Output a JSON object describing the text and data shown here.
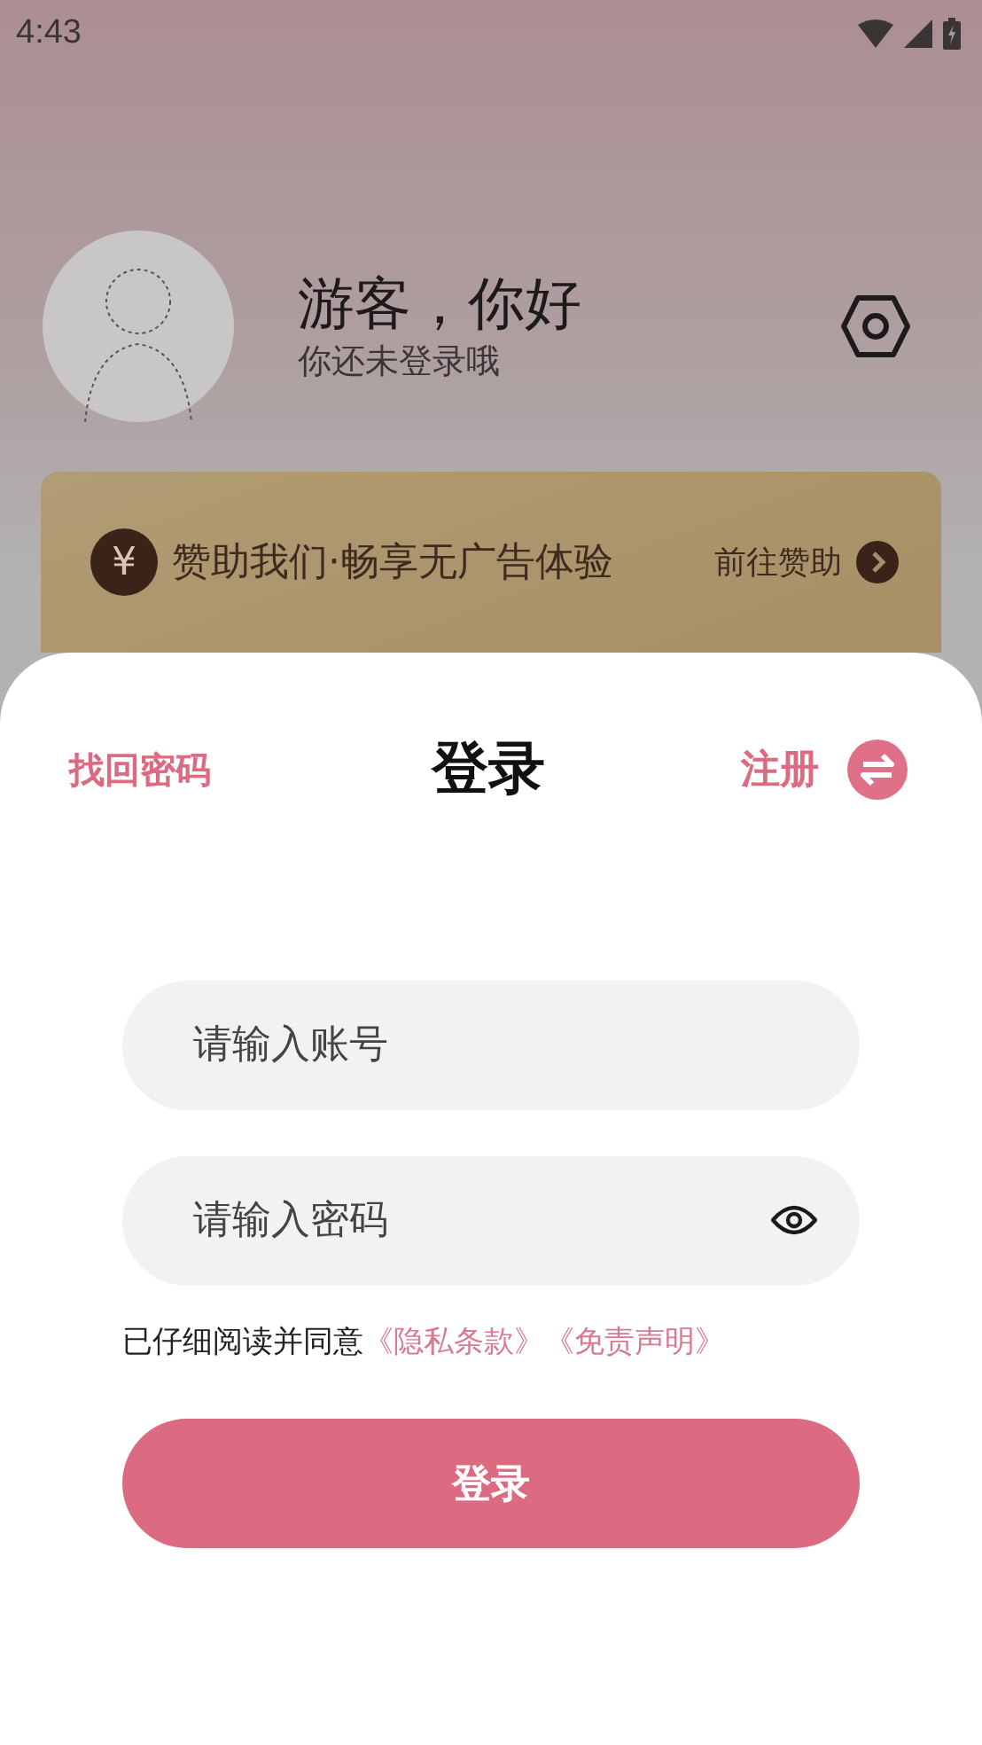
{
  "status_bar": {
    "time": "4:43"
  },
  "profile": {
    "greeting": "游客，你好",
    "subtitle": "你还未登录哦"
  },
  "sponsor_banner": {
    "icon": "¥",
    "text": "赞助我们·畅享无广告体验",
    "action": "前往赞助"
  },
  "login_sheet": {
    "forgot_password": "找回密码",
    "title": "登录",
    "register": "注册",
    "account_field": {
      "placeholder": "请输入账号"
    },
    "password_field": {
      "placeholder": "请输入密码"
    },
    "agreement": {
      "text": "已仔细阅读并同意",
      "links": [
        "《隐私条款》",
        "《免责声明》"
      ]
    },
    "submit": "登录"
  }
}
